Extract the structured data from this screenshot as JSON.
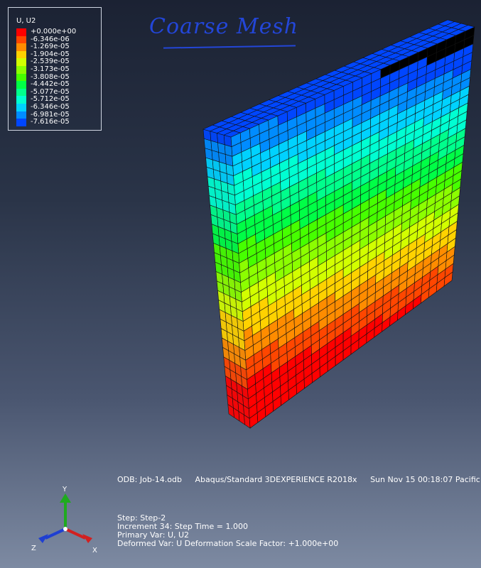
{
  "legend": {
    "title": "U, U2",
    "rows": [
      {
        "label": "+0.000e+00",
        "color": "#ff0000"
      },
      {
        "label": "-6.346e-06",
        "color": "#ff4600"
      },
      {
        "label": "-1.269e-05",
        "color": "#ff8c00"
      },
      {
        "label": "-1.904e-05",
        "color": "#ffd200"
      },
      {
        "label": "-2.539e-05",
        "color": "#d2ff00"
      },
      {
        "label": "-3.173e-05",
        "color": "#8cff00"
      },
      {
        "label": "-3.808e-05",
        "color": "#46ff00"
      },
      {
        "label": "-4.442e-05",
        "color": "#00ff46"
      },
      {
        "label": "-5.077e-05",
        "color": "#00ff8c"
      },
      {
        "label": "-5.712e-05",
        "color": "#00ffd2"
      },
      {
        "label": "-6.346e-05",
        "color": "#00d2ff"
      },
      {
        "label": "-6.981e-05",
        "color": "#008cff"
      },
      {
        "label": "-7.616e-05",
        "color": "#0046ff"
      }
    ]
  },
  "annotation": {
    "text": "Coarse Mesh"
  },
  "odb_line": {
    "odb": "ODB: Job-14.odb",
    "solver": "Abaqus/Standard 3DEXPERIENCE R2018x",
    "date": "Sun Nov 15 00:18:07 Pacific"
  },
  "step_info": {
    "step": "Step: Step-2",
    "increment": "Increment     34: Step Time =      1.000",
    "primary_var": "Primary Var: U, U2",
    "deformed_var": "Deformed Var: U   Deformation Scale Factor: +1.000e+00"
  },
  "triad": {
    "x_label": "X",
    "y_label": "Y",
    "z_label": "Z",
    "x_color": "#d22020",
    "y_color": "#1faa1f",
    "z_color": "#1f3fd2"
  }
}
